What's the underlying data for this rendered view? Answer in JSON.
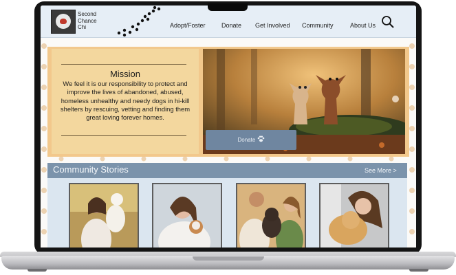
{
  "brand": {
    "name_line1": "Second",
    "name_line2": "Chance",
    "name_line3": "Chi"
  },
  "nav": {
    "items": [
      {
        "label": "Adopt/Foster"
      },
      {
        "label": "Donate"
      },
      {
        "label": "Get Involved"
      },
      {
        "label": "Community"
      },
      {
        "label": "About Us"
      }
    ],
    "search_icon": "search-icon"
  },
  "mission": {
    "title": "Mission",
    "text": "We feel it is our responsibility to protect and improve the lives of abandoned, abused, homeless unhealthy and needy dogs in hi-kill shelters by rescuing, vetting and finding them great loving forever homes."
  },
  "hero": {
    "donate_label": "Donate"
  },
  "community": {
    "title": "Community Stories",
    "see_more": "See More >"
  },
  "colors": {
    "header_bg": "#e6eef6",
    "hero_frame": "#f2c88c",
    "mission_bg": "#f3d79e",
    "accent_blue": "#7b93ab",
    "button_blue": "#6f86a0"
  }
}
